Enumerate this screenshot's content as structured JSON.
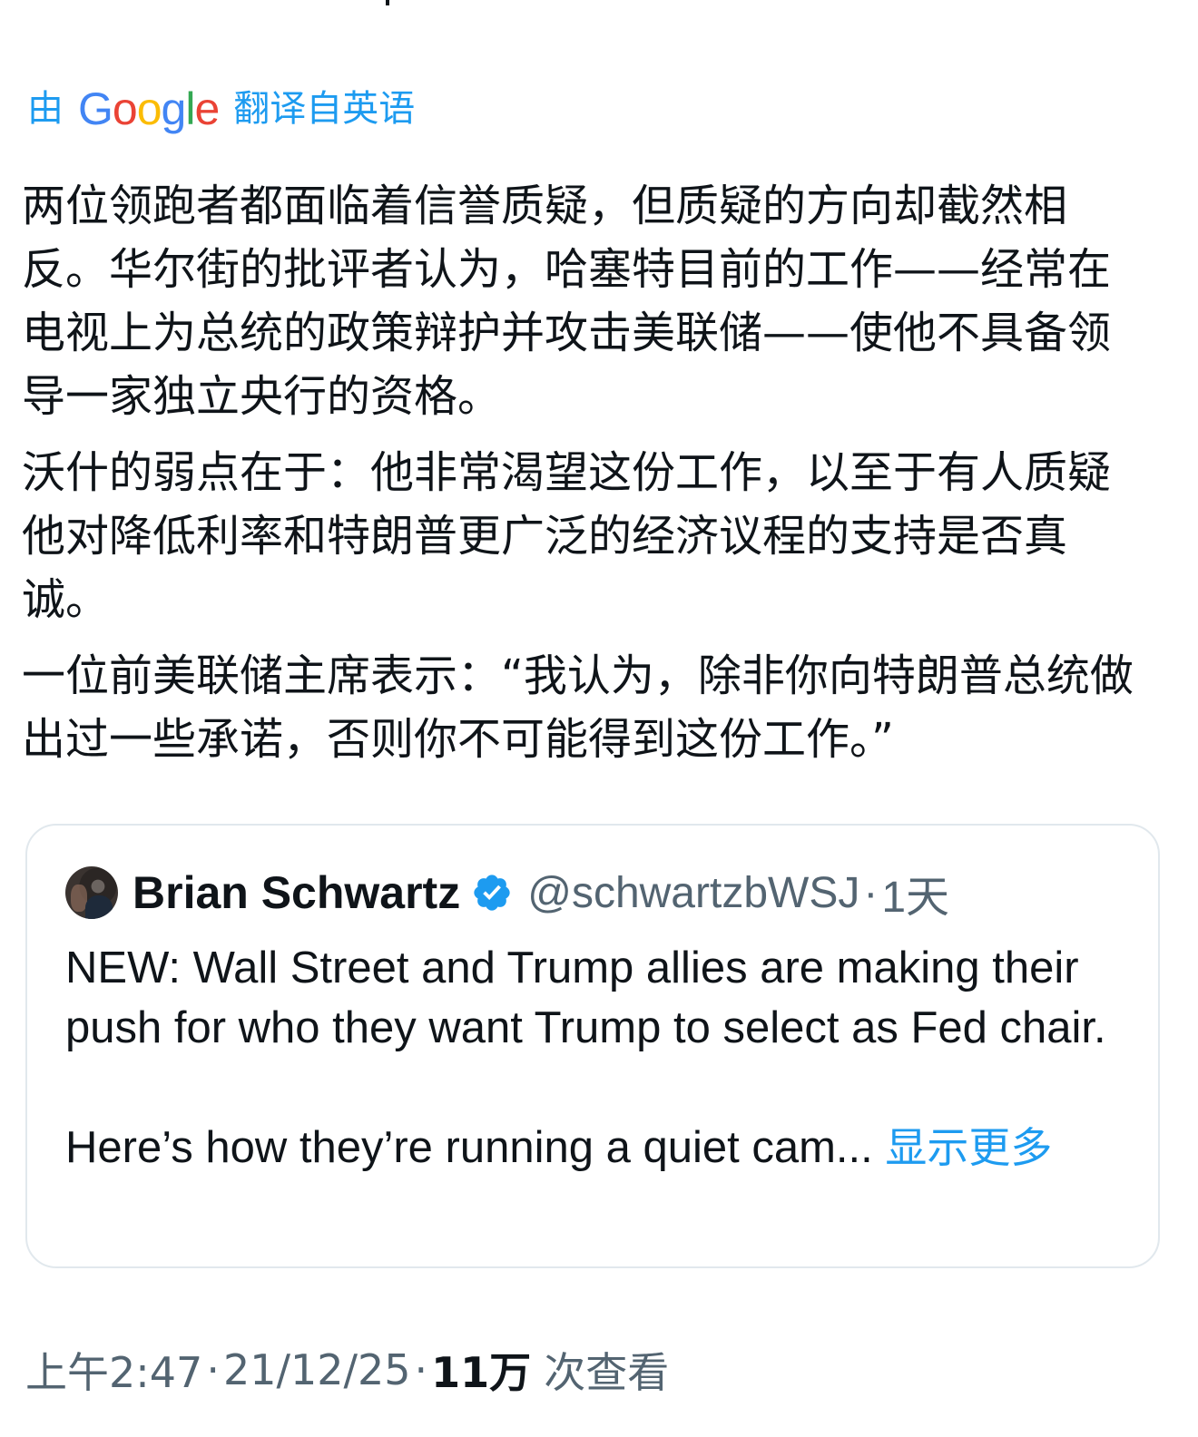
{
  "translation_banner": {
    "prefix": "由",
    "brand": "Google",
    "suffix": "翻译自英语"
  },
  "tweet": {
    "paragraphs": [
      "两位领跑者都面临着信誉质疑，但质疑的方向却截然相反。华尔街的批评者认为，哈塞特目前的工作——经常在电视上为总统的政策辩护并攻击美联储——使他不具备领导一家独立央行的资格。",
      "沃什的弱点在于：他非常渴望这份工作，以至于有人质疑他对降低利率和特朗普更广泛的经济议程的支持是否真诚。",
      "一位前美联储主席表示：“我认为，除非你向特朗普总统做出过一些承诺，否则你不可能得到这份工作。”"
    ]
  },
  "quoted_tweet": {
    "name": "Brian Schwartz",
    "verified_icon": "verified-badge-icon",
    "handle": "@schwartzbWSJ",
    "separator": "·",
    "time": "1天",
    "text_line1": "NEW: Wall Street and Trump allies are making their push for who they want Trump to select as Fed chair.",
    "text_line2": "Here’s how they’re running a quiet cam...",
    "show_more": "显示更多"
  },
  "meta": {
    "time": "上午2:47",
    "sep1": "·",
    "date": "21/12/25",
    "sep2": "·",
    "views_count": "11万",
    "views_label": "次查看"
  },
  "colors": {
    "accent": "#1d9bf0",
    "text": "#0f1419",
    "secondary": "#536471",
    "border": "#e1e8ed"
  }
}
